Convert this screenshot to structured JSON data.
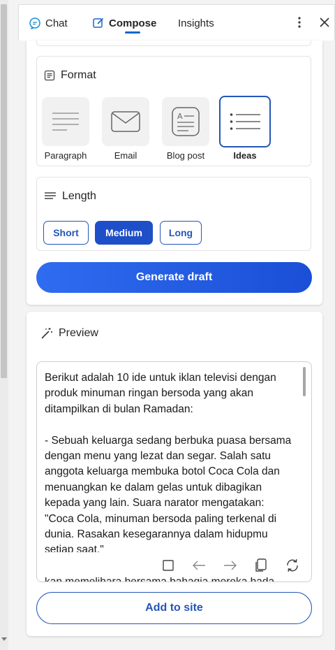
{
  "header": {
    "tabs": [
      {
        "label": "Chat",
        "icon": "chat-icon"
      },
      {
        "label": "Compose",
        "icon": "compose-icon",
        "active": true
      },
      {
        "label": "Insights"
      }
    ],
    "more_icon": "more-vertical-icon",
    "close_icon": "close-icon"
  },
  "format": {
    "title": "Format",
    "options": [
      {
        "label": "Paragraph",
        "icon": "paragraph-icon"
      },
      {
        "label": "Email",
        "icon": "email-icon"
      },
      {
        "label": "Blog post",
        "icon": "blog-post-icon"
      },
      {
        "label": "Ideas",
        "icon": "ideas-icon",
        "selected": true
      }
    ]
  },
  "length": {
    "title": "Length",
    "options": [
      {
        "label": "Short"
      },
      {
        "label": "Medium",
        "selected": true
      },
      {
        "label": "Long"
      }
    ]
  },
  "generate_label": "Generate draft",
  "preview": {
    "title": "Preview",
    "text": "Berikut adalah 10 ide untuk iklan televisi dengan produk minuman ringan bersoda yang akan ditampilkan di bulan Ramadan:\n\n- Sebuah keluarga sedang berbuka puasa bersama dengan menu yang lezat dan segar. Salah satu anggota keluarga membuka botol Coca Cola dan menuangkan ke dalam gelas untuk dibagikan kepada yang lain. Suara narator mengatakan: \"Coca Cola, minuman bersoda paling terkenal di dunia. Rasakan kesegarannya dalam hidupmu setiap saat.\"",
    "cut_text": "kan memelihara bersama bahagia mereka hada"
  },
  "add_label": "Add to site",
  "colors": {
    "accent": "#1e4fc9",
    "accent_border": "#2456b8",
    "generate_gradient_start": "#2f6cf0",
    "generate_gradient_end": "#1a4fd6"
  }
}
